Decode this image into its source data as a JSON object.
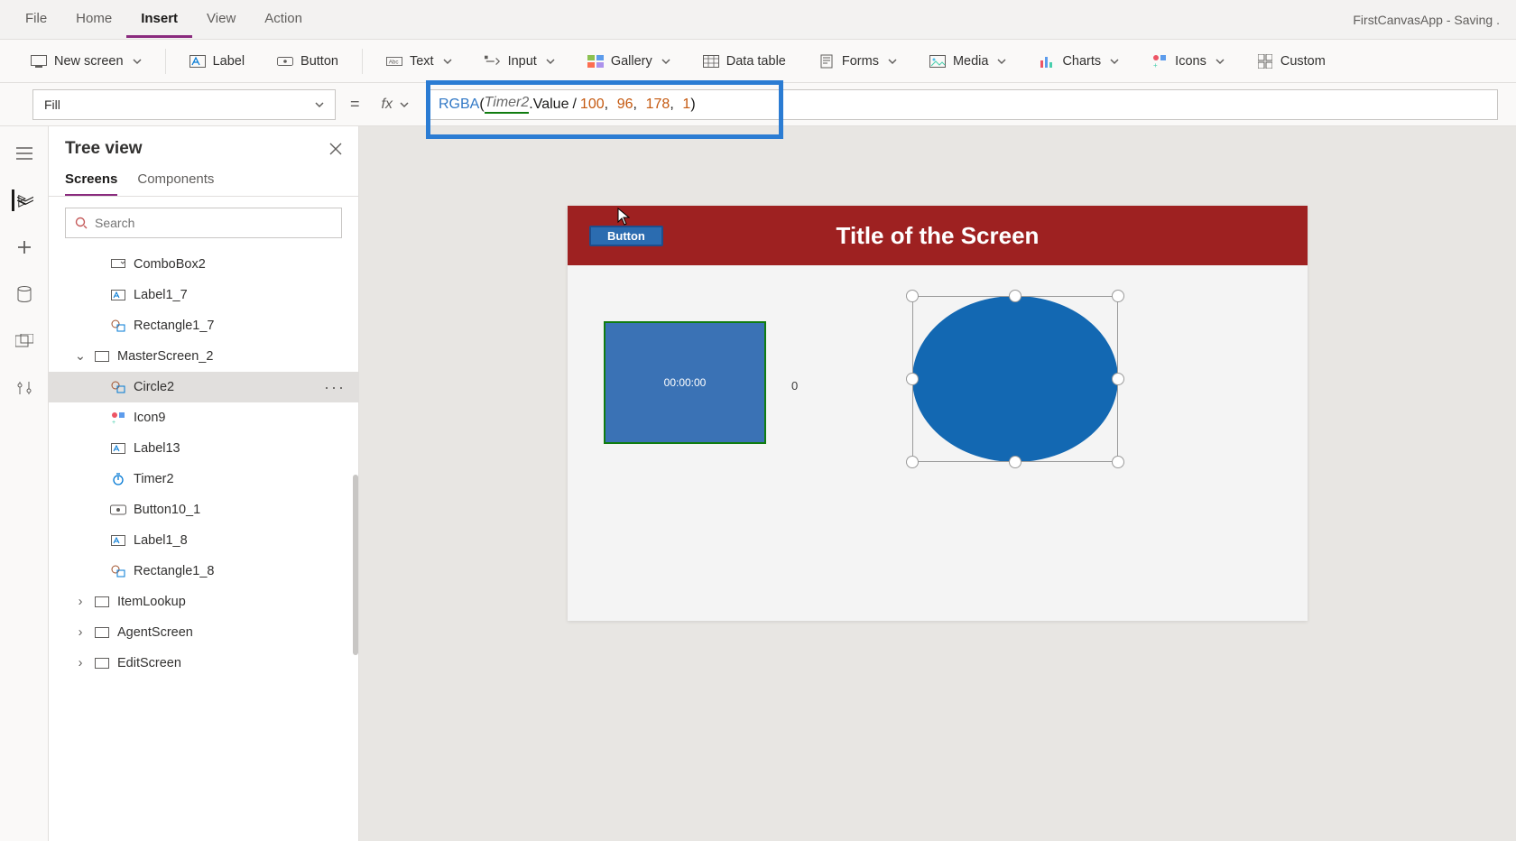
{
  "app": {
    "title_status": "FirstCanvasApp - Saving ."
  },
  "menubar": {
    "file": "File",
    "home": "Home",
    "insert": "Insert",
    "view": "View",
    "action": "Action",
    "active": "Insert"
  },
  "ribbon": {
    "new_screen": "New screen",
    "label": "Label",
    "button": "Button",
    "text": "Text",
    "input": "Input",
    "gallery": "Gallery",
    "data_table": "Data table",
    "forms": "Forms",
    "media": "Media",
    "charts": "Charts",
    "icons": "Icons",
    "custom": "Custom"
  },
  "formula": {
    "property": "Fill",
    "fx_label": "fx",
    "tokens": {
      "fn": "RGBA",
      "open": "(",
      "ref": "Timer2",
      "dot": ".",
      "prop": "Value",
      "div": "/",
      "n1": "100",
      "c1": ",",
      "n2": "96",
      "c2": ",",
      "n3": "178",
      "c3": ",",
      "n4": "1",
      "close": ")"
    }
  },
  "tree": {
    "title": "Tree view",
    "tab_screens": "Screens",
    "tab_components": "Components",
    "search_placeholder": "Search",
    "nodes": [
      {
        "label": "ComboBox2",
        "icon": "combo",
        "indent": 2
      },
      {
        "label": "Label1_7",
        "icon": "label",
        "indent": 2
      },
      {
        "label": "Rectangle1_7",
        "icon": "shape",
        "indent": 2
      },
      {
        "label": "MasterScreen_2",
        "icon": "screen",
        "indent": 0,
        "expanded": true
      },
      {
        "label": "Circle2",
        "icon": "shape",
        "indent": 2,
        "selected": true
      },
      {
        "label": "Icon9",
        "icon": "iconctrl",
        "indent": 2
      },
      {
        "label": "Label13",
        "icon": "label",
        "indent": 2
      },
      {
        "label": "Timer2",
        "icon": "timer",
        "indent": 2
      },
      {
        "label": "Button10_1",
        "icon": "button",
        "indent": 2
      },
      {
        "label": "Label1_8",
        "icon": "label",
        "indent": 2
      },
      {
        "label": "Rectangle1_8",
        "icon": "shape",
        "indent": 2
      },
      {
        "label": "ItemLookup",
        "icon": "screen",
        "indent": 0,
        "collapsed": true
      },
      {
        "label": "AgentScreen",
        "icon": "screen",
        "indent": 0,
        "collapsed": true
      },
      {
        "label": "EditScreen",
        "icon": "screen",
        "indent": 0,
        "collapsed": true
      }
    ]
  },
  "canvas": {
    "screen_title": "Title of the Screen",
    "header_button": "Button",
    "timer_text": "00:00:00",
    "zero_label": "0"
  }
}
